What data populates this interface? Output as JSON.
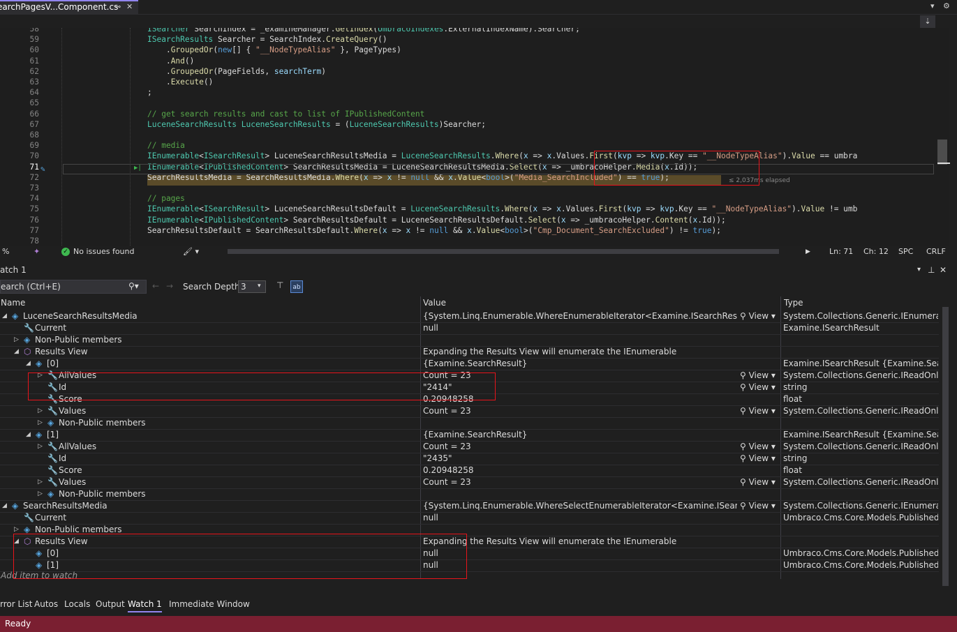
{
  "tab": {
    "title": "earchPagesV...Component.cs",
    "pin": "⊸",
    "close": "✕"
  },
  "editor": {
    "lines": [
      {
        "n": "58",
        "code": "ISearcher SearchIndex = _examineManager.GetIndex(UmbracoIndexes.ExternalIndexName).Searcher;"
      },
      {
        "n": "59",
        "code": "ISearchResults Searcher = SearchIndex.CreateQuery()"
      },
      {
        "n": "60",
        "code": "    .GroupedOr(new[] { \"__NodeTypeAlias\" }, PageTypes)"
      },
      {
        "n": "61",
        "code": "    .And()"
      },
      {
        "n": "62",
        "code": "    .GroupedOr(PageFields, searchTerm)"
      },
      {
        "n": "63",
        "code": "    .Execute()"
      },
      {
        "n": "64",
        "code": ";"
      },
      {
        "n": "65",
        "code": ""
      },
      {
        "n": "66",
        "code": "// get search results and cast to list of IPublishedContent"
      },
      {
        "n": "67",
        "code": "LuceneSearchResults LuceneSearchResults = (LuceneSearchResults)Searcher;"
      },
      {
        "n": "68",
        "code": ""
      },
      {
        "n": "69",
        "code": "// media"
      },
      {
        "n": "70",
        "code": "IEnumerable<ISearchResult> LuceneSearchResultsMedia = LuceneSearchResults.Where(x => x.Values.First(kvp => kvp.Key == \"__NodeTypeAlias\").Value == \"umbra"
      },
      {
        "n": "71",
        "code": "IEnumerable<IPublishedContent> SearchResultsMedia = LuceneSearchResultsMedia.Select(x => _umbracoHelper.Media(x.Id));"
      },
      {
        "n": "72",
        "code": "SearchResultsMedia = SearchResultsMedia.Where(x => x != null && x.Value<bool>(\"Media_SearchIncluded\") == true);"
      },
      {
        "n": "73",
        "code": ""
      },
      {
        "n": "74",
        "code": "// pages"
      },
      {
        "n": "75",
        "code": "IEnumerable<ISearchResult> LuceneSearchResultsDefault = LuceneSearchResults.Where(x => x.Values.First(kvp => kvp.Key == \"__NodeTypeAlias\").Value != \"umb"
      },
      {
        "n": "76",
        "code": "IEnumerable<IPublishedContent> SearchResultsDefault = LuceneSearchResultsDefault.Select(x => _umbracoHelper.Content(x.Id));"
      },
      {
        "n": "77",
        "code": "SearchResultsDefault = SearchResultsDefault.Where(x => x != null && x.Value<bool>(\"Cmp_Document_SearchExcluded\") != true);"
      },
      {
        "n": "78",
        "code": ""
      }
    ],
    "elapsed": "≤ 2,037ms elapsed"
  },
  "edstatus": {
    "zoom": "%",
    "issues": "No issues found",
    "ln": "Ln: 71",
    "ch": "Ch: 12",
    "spc": "SPC",
    "crlf": "CRLF"
  },
  "watch": {
    "title": "atch 1",
    "search_placeholder": "earch (Ctrl+E)",
    "depth_label": "Search Depth:",
    "depth_value": "3",
    "col_name": "Name",
    "col_value": "Value",
    "col_type": "Type",
    "view_label": "View",
    "add_item": "Add item to watch",
    "rows": [
      {
        "indent": 0,
        "exp": "open",
        "icon": "obj",
        "name": "LuceneSearchResultsMedia",
        "value": "{System.Linq.Enumerable.WhereEnumerableIterator<Examine.ISearchResult>}",
        "view": true,
        "type": "System.Collections.Generic.IEnumerabl..."
      },
      {
        "indent": 1,
        "exp": "",
        "icon": "wr",
        "name": "Current",
        "value": "null",
        "view": false,
        "type": "Examine.ISearchResult"
      },
      {
        "indent": 1,
        "exp": "closed",
        "icon": "obj",
        "name": "Non-Public members",
        "value": "",
        "view": false,
        "type": ""
      },
      {
        "indent": 1,
        "exp": "open",
        "icon": "rv",
        "name": "Results View",
        "value": "Expanding the Results View will enumerate the IEnumerable",
        "view": false,
        "type": ""
      },
      {
        "indent": 2,
        "exp": "open",
        "icon": "obj",
        "name": "[0]",
        "value": "{Examine.SearchResult}",
        "view": false,
        "type": "Examine.ISearchResult {Examine.Search..."
      },
      {
        "indent": 3,
        "exp": "closed",
        "icon": "wr",
        "name": "AllValues",
        "value": "Count = 23",
        "view": true,
        "type": "System.Collections.Generic.IReadOnlyDi..."
      },
      {
        "indent": 3,
        "exp": "",
        "icon": "wr",
        "name": "Id",
        "value": "\"2414\"",
        "view": true,
        "type": "string"
      },
      {
        "indent": 3,
        "exp": "",
        "icon": "wr",
        "name": "Score",
        "value": "0.20948258",
        "view": false,
        "type": "float"
      },
      {
        "indent": 3,
        "exp": "closed",
        "icon": "wr",
        "name": "Values",
        "value": "Count = 23",
        "view": true,
        "type": "System.Collections.Generic.IReadOnlyDi..."
      },
      {
        "indent": 3,
        "exp": "closed",
        "icon": "obj",
        "name": "Non-Public members",
        "value": "",
        "view": false,
        "type": ""
      },
      {
        "indent": 2,
        "exp": "open",
        "icon": "obj",
        "name": "[1]",
        "value": "{Examine.SearchResult}",
        "view": false,
        "type": "Examine.ISearchResult {Examine.Search..."
      },
      {
        "indent": 3,
        "exp": "closed",
        "icon": "wr",
        "name": "AllValues",
        "value": "Count = 23",
        "view": true,
        "type": "System.Collections.Generic.IReadOnlyDi..."
      },
      {
        "indent": 3,
        "exp": "",
        "icon": "wr",
        "name": "Id",
        "value": "\"2435\"",
        "view": true,
        "type": "string"
      },
      {
        "indent": 3,
        "exp": "",
        "icon": "wr",
        "name": "Score",
        "value": "0.20948258",
        "view": false,
        "type": "float"
      },
      {
        "indent": 3,
        "exp": "closed",
        "icon": "wr",
        "name": "Values",
        "value": "Count = 23",
        "view": true,
        "type": "System.Collections.Generic.IReadOnlyDi..."
      },
      {
        "indent": 3,
        "exp": "closed",
        "icon": "obj",
        "name": "Non-Public members",
        "value": "",
        "view": false,
        "type": ""
      },
      {
        "indent": 0,
        "exp": "open",
        "icon": "obj",
        "name": "SearchResultsMedia",
        "value": "{System.Linq.Enumerable.WhereSelectEnumerableIterator<Examine.ISearchResult, U...",
        "view": true,
        "type": "System.Collections.Generic.IEnumerabl..."
      },
      {
        "indent": 1,
        "exp": "",
        "icon": "wr",
        "name": "Current",
        "value": "null",
        "view": false,
        "type": "Umbraco.Cms.Core.Models.PublishedC..."
      },
      {
        "indent": 1,
        "exp": "closed",
        "icon": "obj",
        "name": "Non-Public members",
        "value": "",
        "view": false,
        "type": ""
      },
      {
        "indent": 1,
        "exp": "open",
        "icon": "rv",
        "name": "Results View",
        "value": "Expanding the Results View will enumerate the IEnumerable",
        "view": false,
        "type": ""
      },
      {
        "indent": 2,
        "exp": "",
        "icon": "obj",
        "name": "[0]",
        "value": "null",
        "view": false,
        "type": "Umbraco.Cms.Core.Models.PublishedC..."
      },
      {
        "indent": 2,
        "exp": "",
        "icon": "obj",
        "name": "[1]",
        "value": "null",
        "view": false,
        "type": "Umbraco.Cms.Core.Models.PublishedC..."
      }
    ]
  },
  "bottom_tabs": [
    {
      "label": "rror List",
      "active": false
    },
    {
      "label": "Autos",
      "active": false
    },
    {
      "label": "Locals",
      "active": false
    },
    {
      "label": "Output",
      "active": false
    },
    {
      "label": "Watch 1",
      "active": true
    },
    {
      "label": "Immediate Window",
      "active": false
    }
  ],
  "status": {
    "text": "Ready"
  },
  "colors": {
    "accent": "#9184ee",
    "statusbar": "#7a1f31",
    "highlight": "#e8141b"
  }
}
